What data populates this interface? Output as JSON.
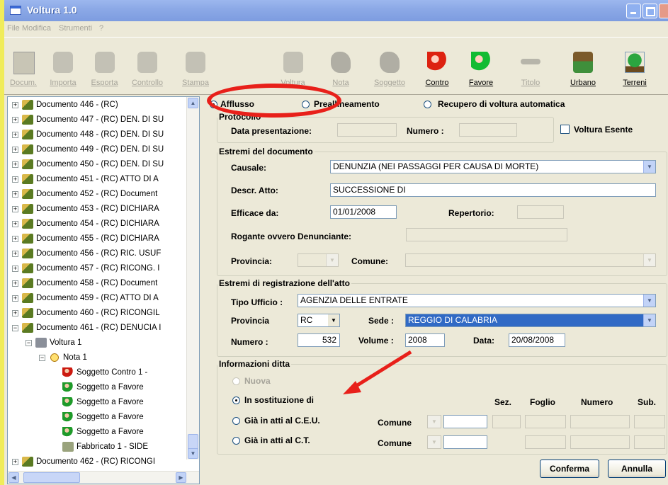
{
  "window": {
    "title": "Voltura 1.0"
  },
  "menu": [
    "File",
    "Modifica",
    "Strumenti",
    "?"
  ],
  "toolbar": [
    {
      "label": "Docum.",
      "icon": "document-icon",
      "enabled": false
    },
    {
      "label": "Importa",
      "icon": "import-icon",
      "enabled": false
    },
    {
      "label": "Esporta",
      "icon": "export-icon",
      "enabled": false
    },
    {
      "label": "Controllo",
      "icon": "check-icon",
      "enabled": false
    },
    {
      "label": "Stampa",
      "icon": "print-icon",
      "enabled": false
    },
    {
      "label": "Voltura",
      "icon": "voltura-icon",
      "enabled": false
    },
    {
      "label": "Nota",
      "icon": "note-icon",
      "enabled": false
    },
    {
      "label": "Soggetto",
      "icon": "person-icon",
      "enabled": false
    },
    {
      "label": "Contro",
      "icon": "person-red-icon",
      "enabled": true
    },
    {
      "label": "Favore",
      "icon": "person-green-icon",
      "enabled": true
    },
    {
      "label": "Titolo",
      "icon": "title-icon",
      "enabled": false
    },
    {
      "label": "Urbano",
      "icon": "house-icon",
      "enabled": true
    },
    {
      "label": "Terreni",
      "icon": "tree-icon",
      "enabled": true
    }
  ],
  "tree": [
    "Documento 446 - (RC)",
    "Documento 447 - (RC) DEN. DI SU",
    "Documento 448 - (RC) DEN. DI SU",
    "Documento 449 - (RC) DEN. DI SU",
    "Documento 450 - (RC) DEN. DI SU",
    "Documento 451 - (RC) ATTO DI A",
    "Documento 452 - (RC) Document",
    "Documento 453 - (RC) DICHIARA",
    "Documento 454 - (RC) DICHIARA",
    "Documento 455 - (RC) DICHIARA",
    "Documento 456 - (RC) RIC. USUF",
    "Documento 457 - (RC) RICONG. I",
    "Documento 458 - (RC) Document",
    "Documento 459 - (RC) ATTO DI A",
    "Documento 460 - (RC) RICONGIL",
    "Documento 461 - (RC) DENUCIA I",
    "Voltura  1",
    "Nota  1",
    "Soggetto Contro  1 -",
    "Soggetto a Favore",
    "Soggetto a Favore",
    "Soggetto a Favore",
    "Soggetto a Favore",
    "Fabbricato  1 - SIDE",
    "Documento 462 - (RC) RICONGI"
  ],
  "form": {
    "modes": [
      "Afflusso",
      "Preallineamento",
      "Recupero di voltura automatica"
    ],
    "protocollo": {
      "title": "Protocollo",
      "data_label": "Data presentazione:",
      "numero_label": "Numero :",
      "esente_label": "Voltura Esente"
    },
    "estremi": {
      "title": "Estremi del documento",
      "causale_label": "Causale:",
      "causale_value": "DENUNZIA (NEI PASSAGGI PER CAUSA DI MORTE)",
      "descr_label": "Descr. Atto:",
      "descr_value": "SUCCESSIONE DI",
      "efficace_label": "Efficace da:",
      "efficace_value": "01/01/2008",
      "repertorio_label": "Repertorio:",
      "rogante_label": "Rogante ovvero Denunciante:",
      "provincia_label": "Provincia:",
      "comune_label": "Comune:"
    },
    "registrazione": {
      "title": "Estremi di registrazione dell'atto",
      "tipo_label": "Tipo Ufficio :",
      "tipo_value": "AGENZIA DELLE ENTRATE",
      "provincia_label": "Provincia",
      "provincia_value": "RC",
      "sede_label": "Sede :",
      "sede_value": "REGGIO DI CALABRIA",
      "numero_label": "Numero :",
      "numero_value": "532",
      "volume_label": "Volume :",
      "volume_value": "2008",
      "data_label": "Data:",
      "data_value": "20/08/2008"
    },
    "ditta": {
      "title": "Informazioni ditta",
      "nuova": "Nuova",
      "sostituzione": "In sostituzione di",
      "ceu": "Già in atti al C.E.U.",
      "ct": "Già in atti al C.T.",
      "comune_label": "Comune",
      "sez": "Sez.",
      "foglio": "Foglio",
      "numero": "Numero",
      "sub": "Sub."
    },
    "buttons": {
      "conferma": "Conferma",
      "annulla": "Annulla"
    }
  }
}
